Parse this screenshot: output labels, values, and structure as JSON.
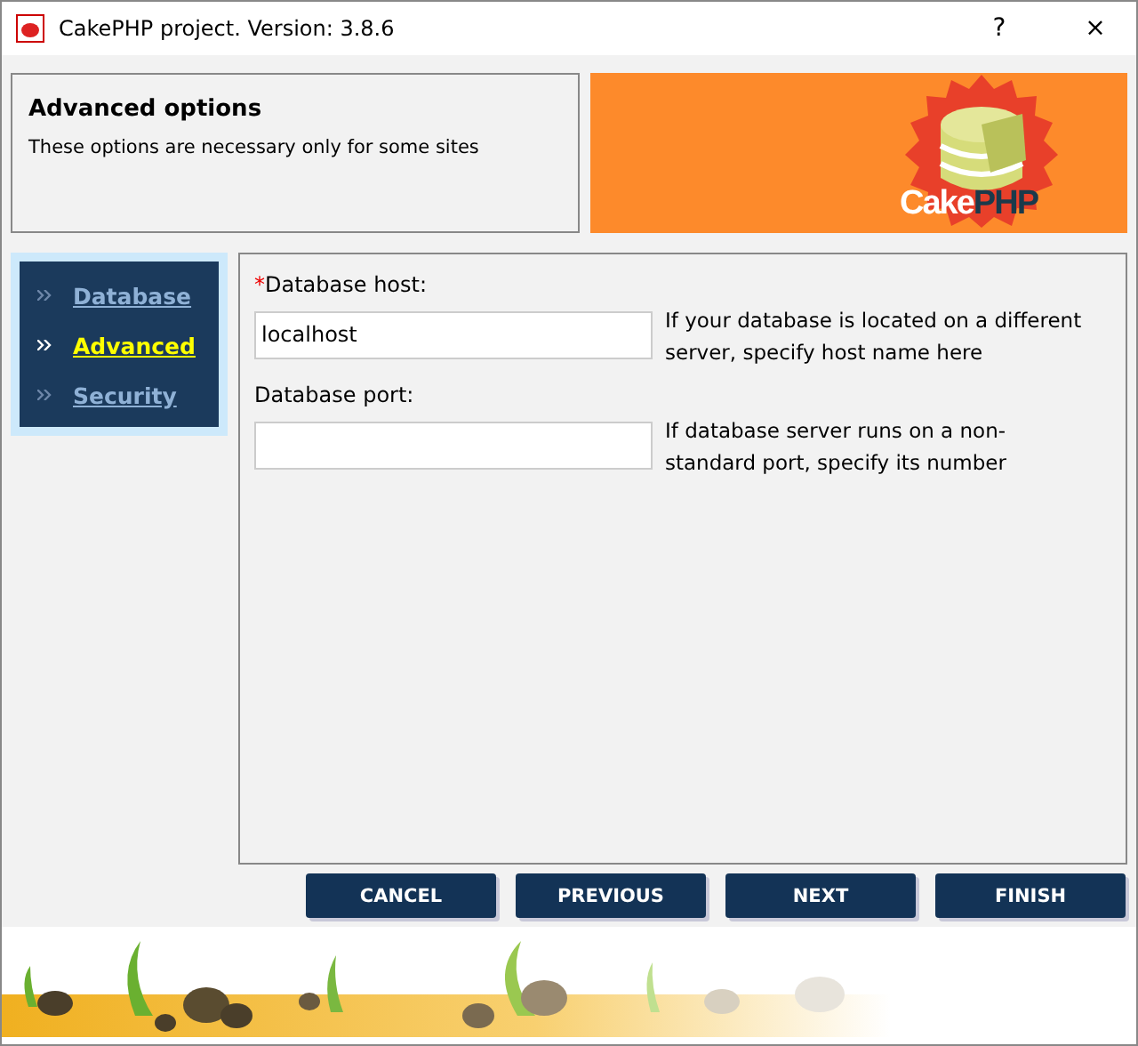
{
  "window": {
    "title": "CakePHP project. Version: 3.8.6",
    "help": "?",
    "close": "×"
  },
  "header": {
    "title": "Advanced options",
    "subtitle": "These options are necessary only for some sites",
    "logo": {
      "word": "Cake",
      "word_2": "PHP"
    }
  },
  "nav": [
    {
      "label": "Database",
      "selected": false
    },
    {
      "label": "Advanced",
      "selected": true
    },
    {
      "label": "Security",
      "selected": false
    }
  ],
  "fields": [
    {
      "label": "Database host:",
      "required_mark": "*",
      "value": "localhost",
      "help": "If your database is located on a different server, specify host name here"
    },
    {
      "label": "Database port:",
      "help": "If database server runs on a non-standard port, specify its number"
    }
  ],
  "buttons": [
    "CANCEL",
    "PREVIOUS",
    "NEXT",
    "FINISH"
  ]
}
